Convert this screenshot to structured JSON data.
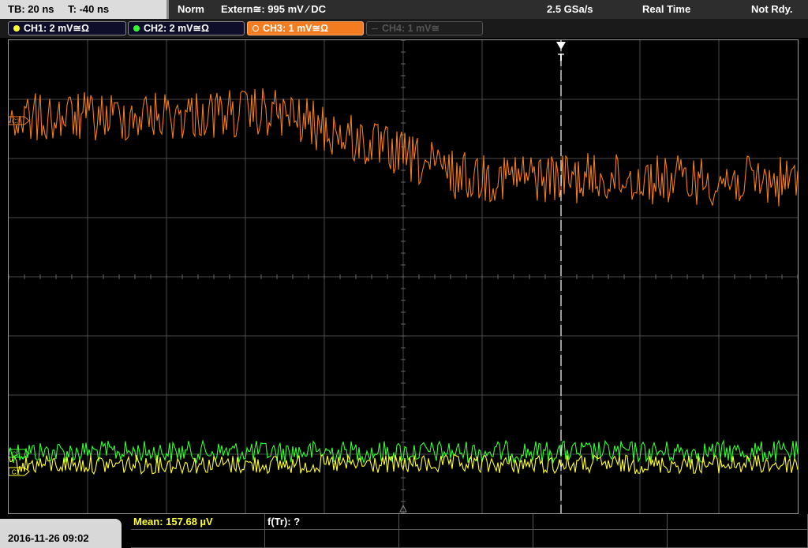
{
  "header": {
    "timebase": "TB: 20 ns",
    "trigger_offset": "T: -40 ns",
    "trigger_mode": "Norm",
    "trigger_source": "Extern≅: 995 mV ⁄ DC",
    "sample_rate": "2.5 GSa/s",
    "acq_mode": "Real Time",
    "status": "Not Rdy."
  },
  "channels": [
    {
      "label": "CH1: 2 mV≅Ω",
      "color": "#ffff33",
      "state": "on"
    },
    {
      "label": "CH2: 2 mV≅Ω",
      "color": "#33ff33",
      "state": "on"
    },
    {
      "label": "CH3: 1 mV≅Ω",
      "color": "#f47c20",
      "state": "active"
    },
    {
      "label": "CH4: 1 mV≅",
      "color": "#555555",
      "state": "off"
    }
  ],
  "markers": {
    "trigger": "T",
    "ch1": "C1",
    "ch2": "C2",
    "ch3": "C3"
  },
  "footer": {
    "datetime": "2016-11-26 09:02",
    "measure1": "Mean: 157.68 µV",
    "measure2": "f(Tr): ?"
  },
  "colors": {
    "ch1": "#ffff33",
    "ch2": "#33ff33",
    "ch3": "#f47c20",
    "grid": "#4a4a4a"
  }
}
